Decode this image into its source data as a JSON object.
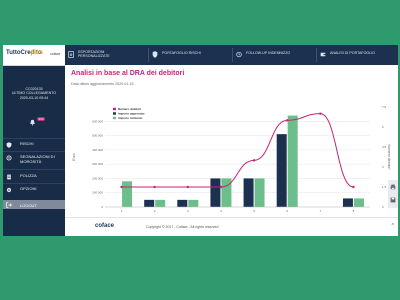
{
  "app": {
    "logo_part1": "TuttoCredito",
    "logo_part2": ".plus",
    "logo_part3": "coface"
  },
  "user": {
    "code": "CC020135",
    "last_login_label": "ULTIMO COLLEGAMENTO",
    "last_login_time": "2020-03-10 09:44",
    "badge": "999"
  },
  "sidebar": {
    "items": [
      {
        "label": "RISCHI",
        "icon": "shield-icon"
      },
      {
        "label": "SEGNALAZIONI DI MOROSITÀ",
        "icon": "gear-icon"
      },
      {
        "label": "POLIZZA",
        "icon": "document-icon"
      },
      {
        "label": "OPZIONI",
        "icon": "gear-icon"
      }
    ],
    "logout": "LOGOUT"
  },
  "topnav": {
    "items": [
      {
        "label_line1": "ESPORTAZIONI",
        "label_line2": "PERSONALIZZATE",
        "icon": "export-icon"
      },
      {
        "label_line1": "PORTAFOGLIO RISCHI",
        "label_line2": "",
        "icon": "shield-icon"
      },
      {
        "label_line1": "FOLLOW-UP INDENNIZZO",
        "label_line2": "",
        "icon": "clock-icon"
      },
      {
        "label_line1": "ANALISI DI PORTAFOGLIO",
        "label_line2": "",
        "icon": "wallet-icon"
      }
    ]
  },
  "page": {
    "title": "Analisi in base al DRA dei debitori",
    "subtitle": "Data ultimo aggiornamento 2020-01-15"
  },
  "chart_data": {
    "type": "bar",
    "categories": [
      "1",
      "2",
      "3",
      "4",
      "5",
      "6",
      "7",
      "8"
    ],
    "series": [
      {
        "name": "Numero debitori",
        "type": "line",
        "axis": "right",
        "values": [
          1.5,
          1.5,
          1.5,
          1.5,
          3.5,
          6.5,
          7.0,
          1.5
        ],
        "color": "#c0267a"
      },
      {
        "name": "Importo approvato",
        "type": "bar",
        "axis": "left",
        "values": [
          0,
          50000,
          50000,
          200000,
          200000,
          510000,
          0,
          60000
        ],
        "color": "#1c3150"
      },
      {
        "name": "Importo richiesto",
        "type": "bar",
        "axis": "left",
        "values": [
          180000,
          50000,
          50000,
          200000,
          200000,
          640000,
          0,
          60000
        ],
        "color": "#6cbf8a"
      }
    ],
    "ylabel_left": "Euro",
    "ylabel_right": "Numero debitori",
    "yticks_left": [
      "0",
      "100 000",
      "200 000",
      "300 000",
      "400 000",
      "500 000",
      "600 000"
    ],
    "yticks_right": [
      "0",
      "1.5",
      "3",
      "4.5",
      "6",
      "7.5"
    ],
    "ylim_left": [
      0,
      700000
    ],
    "ylim_right": [
      0,
      7.5
    ],
    "legend_position": "top-left",
    "grid": true
  },
  "footer": {
    "brand": "coface",
    "copyright": "Copyright © 2017 - Coface - All rights reserved",
    "up_arrow": "^"
  },
  "colors": {
    "background": "#2e9a6d",
    "sidebar": "#182c47",
    "topnav": "#1c3150",
    "accent": "#c0267a"
  }
}
